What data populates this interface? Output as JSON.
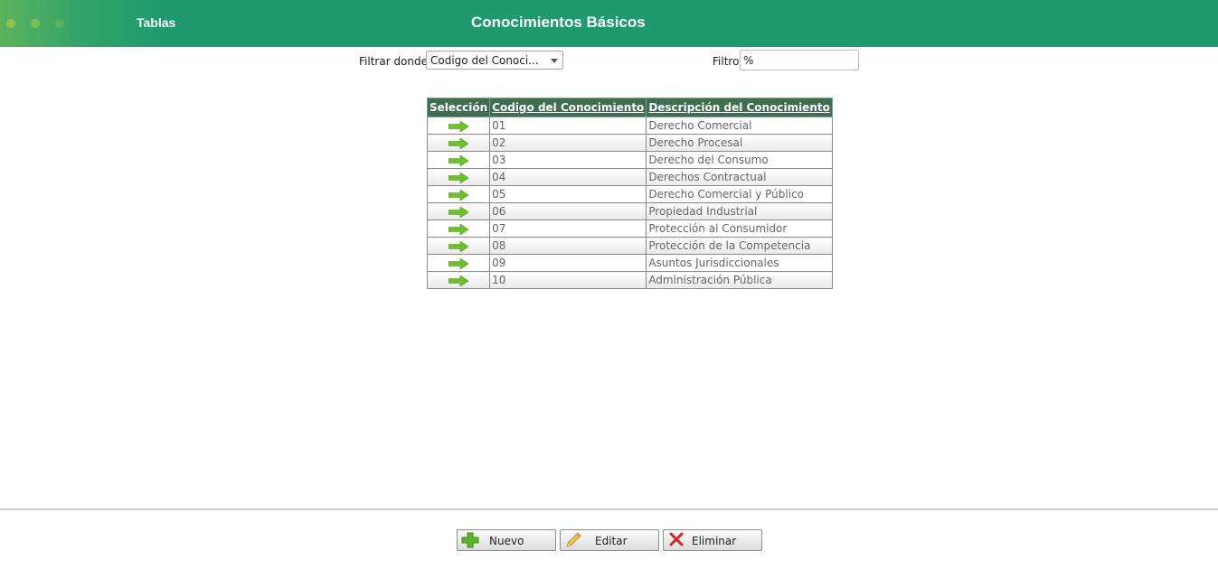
{
  "header": {
    "app_title": "Tablas",
    "page_title": "Conocimientos Básicos",
    "bg_color": "#1e9a6c"
  },
  "filter": {
    "where_label": "Filtrar donde",
    "where_value": "Codigo del Conoci...",
    "filter_label": "Filtro",
    "filter_value": "%"
  },
  "table": {
    "columns": [
      "Selección",
      "Codigo del Conocimiento",
      "Descripción del Conocimiento"
    ],
    "rows": [
      {
        "code": "01",
        "desc": "Derecho Comercial"
      },
      {
        "code": "02",
        "desc": "Derecho Procesal"
      },
      {
        "code": "03",
        "desc": "Derecho del Consumo"
      },
      {
        "code": "04",
        "desc": "Derechos Contractual"
      },
      {
        "code": "05",
        "desc": "Derecho Comercial y Público"
      },
      {
        "code": "06",
        "desc": "Propiedad Industrial"
      },
      {
        "code": "07",
        "desc": "Protección al Consumidor"
      },
      {
        "code": "08",
        "desc": "Protección de la Competencia"
      },
      {
        "code": "09",
        "desc": "Asuntos Jurisdiccionales"
      },
      {
        "code": "10",
        "desc": "Administración Pública"
      }
    ],
    "select_icon": "arrow-right-icon",
    "header_color": "#3e6d52",
    "arrow_color": "#6fbf2a"
  },
  "buttons": {
    "new_label": "Nuevo",
    "edit_label": "Editar",
    "delete_label": "Eliminar",
    "new_icon": "plus-icon",
    "edit_icon": "pencil-icon",
    "delete_icon": "x-icon"
  }
}
